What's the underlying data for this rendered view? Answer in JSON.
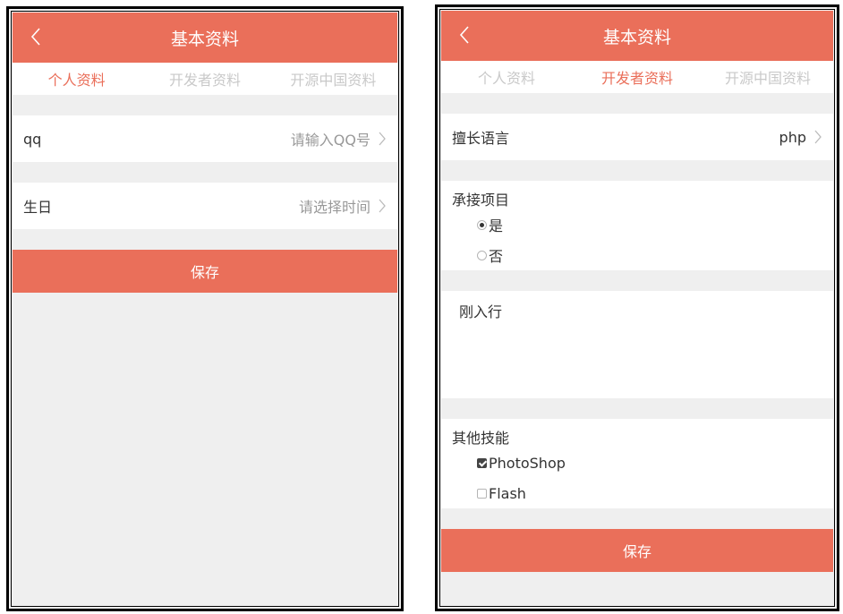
{
  "left": {
    "header_title": "基本资料",
    "tabs": [
      "个人资料",
      "开发者资料",
      "开源中国资料"
    ],
    "active_tab": 0,
    "rows": [
      {
        "label": "qq",
        "value": "请输入QQ号"
      },
      {
        "label": "生日",
        "value": "请选择时间"
      }
    ],
    "save_label": "保存"
  },
  "right": {
    "header_title": "基本资料",
    "tabs": [
      "个人资料",
      "开发者资料",
      "开源中国资料"
    ],
    "active_tab": 1,
    "language_row": {
      "label": "擅长语言",
      "value": "php"
    },
    "project_section": {
      "title": "承接项目",
      "options": [
        {
          "label": "是",
          "selected": true
        },
        {
          "label": "否",
          "selected": false
        }
      ]
    },
    "experience_text": "刚入行",
    "skills_section": {
      "title": "其他技能",
      "options": [
        {
          "label": "PhotoShop",
          "checked": true
        },
        {
          "label": "Flash",
          "checked": false
        }
      ]
    },
    "save_label": "保存"
  },
  "colors": {
    "accent": "#ea6f5a",
    "background": "#efefef",
    "inactive_tab": "#c9c9c9"
  },
  "icons": {
    "back": "chevron-left-icon",
    "row_arrow": "chevron-right-icon"
  }
}
